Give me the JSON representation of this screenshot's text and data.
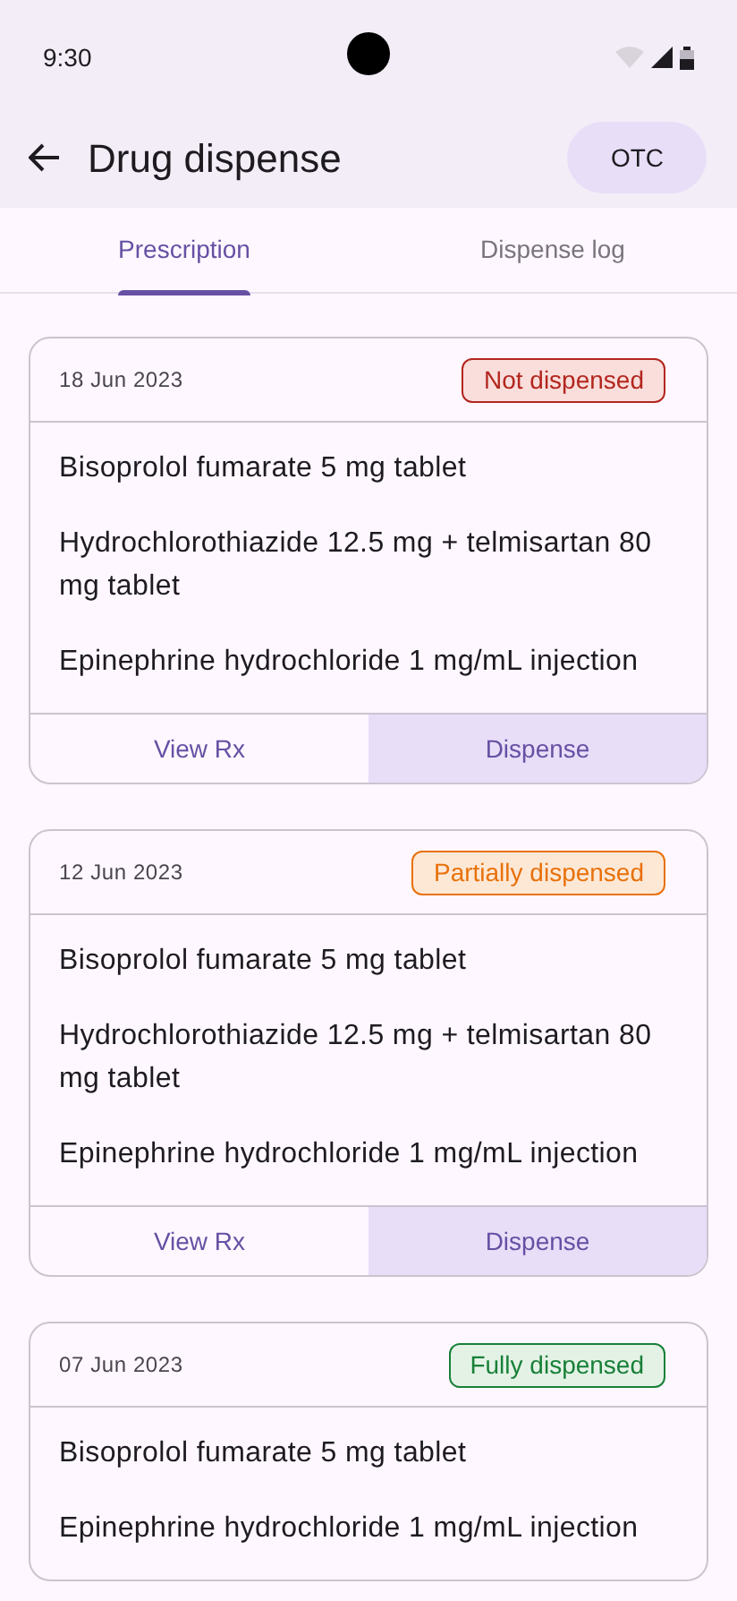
{
  "status_bar": {
    "time": "9:30"
  },
  "app_bar": {
    "title": "Drug dispense",
    "action": "OTC"
  },
  "tabs": [
    {
      "label": "Prescription",
      "selected": true
    },
    {
      "label": "Dispense log",
      "selected": false
    }
  ],
  "prescriptions": [
    {
      "date": "18 Jun 2023",
      "status": {
        "label": "Not dispensed",
        "kind": "none"
      },
      "drugs": [
        "Bisoprolol fumarate 5 mg tablet",
        "Hydrochlorothiazide 12.5 mg + telmisartan 80 mg tablet",
        "Epinephrine hydrochloride 1 mg/mL injection"
      ],
      "actions": [
        "View Rx",
        "Dispense"
      ]
    },
    {
      "date": "12 Jun 2023",
      "status": {
        "label": "Partially dispensed",
        "kind": "partial"
      },
      "drugs": [
        "Bisoprolol fumarate 5 mg tablet",
        "Hydrochlorothiazide 12.5 mg + telmisartan 80 mg tablet",
        "Epinephrine hydrochloride 1 mg/mL injection"
      ],
      "actions": [
        "View Rx",
        "Dispense"
      ]
    },
    {
      "date": "07 Jun 2023",
      "status": {
        "label": "Fully dispensed",
        "kind": "full"
      },
      "drugs": [
        "Bisoprolol fumarate 5 mg tablet",
        "Epinephrine hydrochloride 1 mg/mL injection"
      ]
    }
  ]
}
